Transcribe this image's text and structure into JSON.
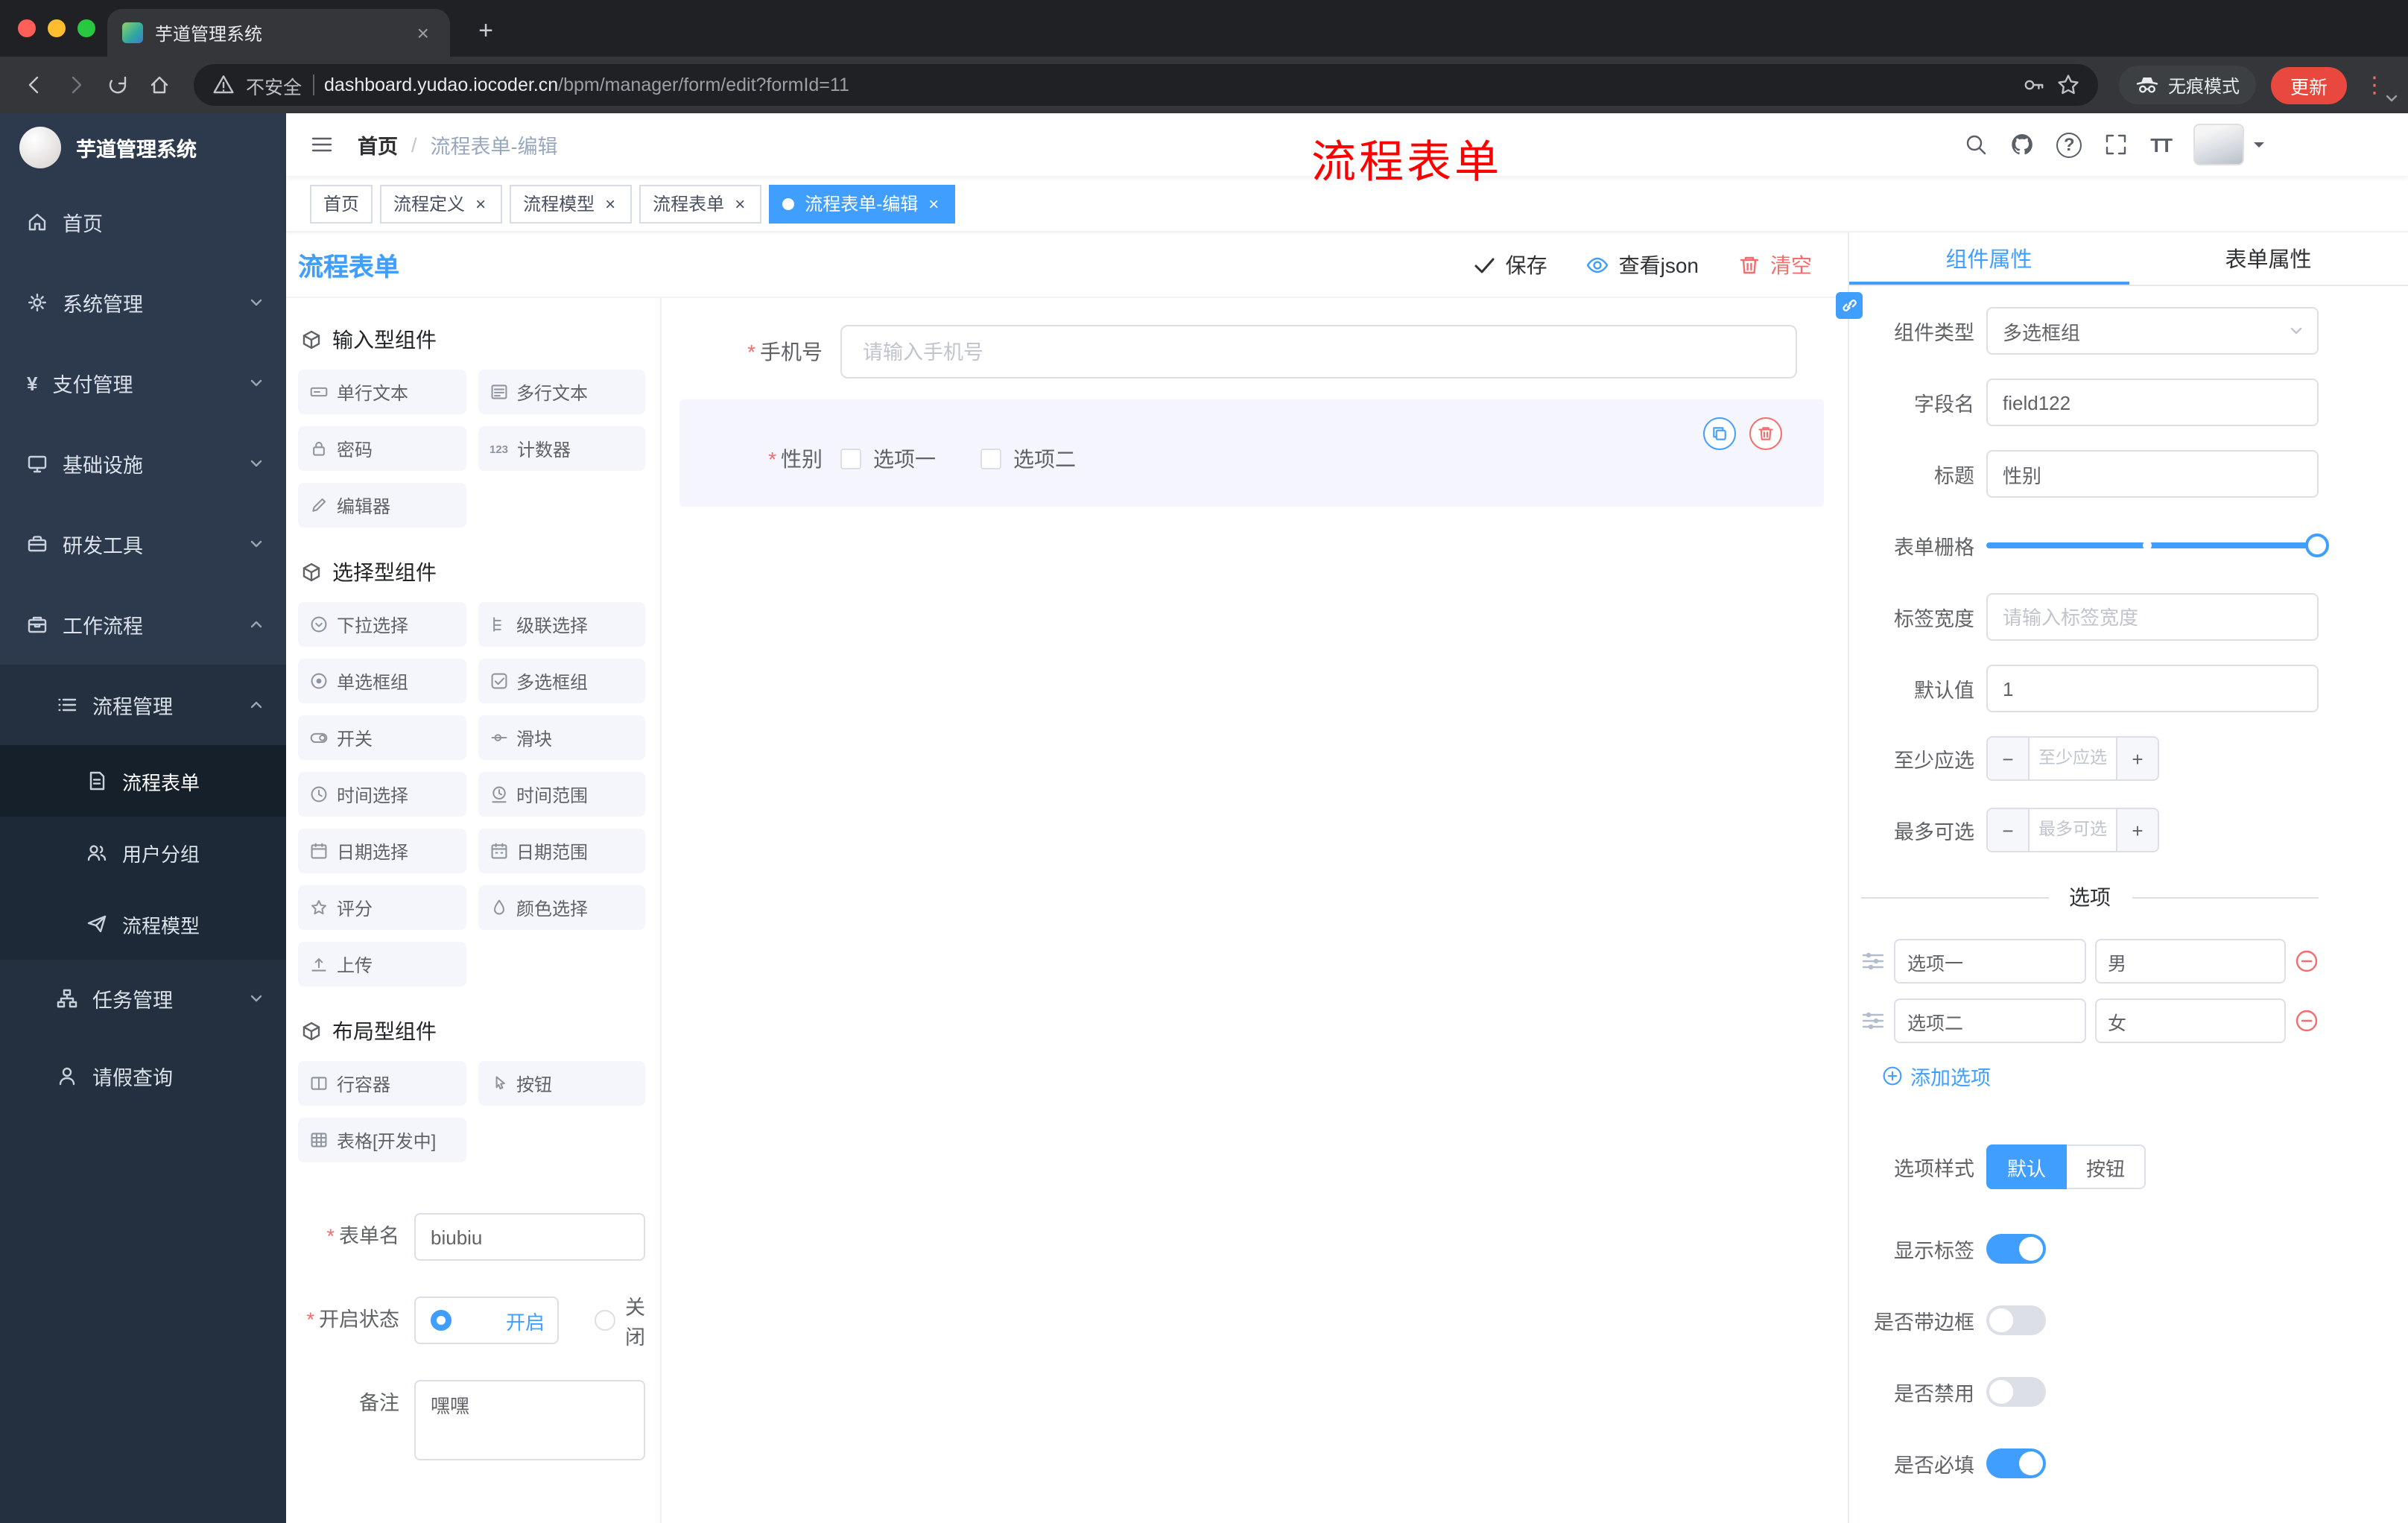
{
  "icons": {
    "close": "×",
    "plus": "+",
    "minus": "−",
    "plus_sign": "+",
    "kebab": "⋮",
    "yen": "¥",
    "counter_badge": "123",
    "font_size": "TT",
    "question_mark": "?",
    "required": "*",
    "breadcrumb_separator": "/"
  },
  "browser": {
    "tab_title": "芋道管理系统",
    "security_label": "不安全",
    "url_domain": "dashboard.yudao.iocoder.cn",
    "url_path": "/bpm/manager/form/edit?formId=11",
    "incognito_label": "无痕模式",
    "update_label": "更新"
  },
  "sidebar": {
    "logo_title": "芋道管理系统",
    "items": [
      {
        "label": "首页"
      },
      {
        "label": "系统管理"
      },
      {
        "label": "支付管理"
      },
      {
        "label": "基础设施"
      },
      {
        "label": "研发工具"
      },
      {
        "label": "工作流程"
      },
      {
        "label": "流程管理"
      },
      {
        "label": "流程表单"
      },
      {
        "label": "用户分组"
      },
      {
        "label": "流程模型"
      },
      {
        "label": "任务管理"
      },
      {
        "label": "请假查询"
      }
    ]
  },
  "navbar": {
    "breadcrumb": [
      "首页",
      "流程表单-编辑"
    ],
    "annotation": "流程表单"
  },
  "tags": [
    {
      "label": "首页",
      "closable": false,
      "active": false
    },
    {
      "label": "流程定义",
      "closable": true,
      "active": false
    },
    {
      "label": "流程模型",
      "closable": true,
      "active": false
    },
    {
      "label": "流程表单",
      "closable": true,
      "active": false
    },
    {
      "label": "流程表单-编辑",
      "closable": true,
      "active": true
    }
  ],
  "designer": {
    "title": "流程表单",
    "save_label": "保存",
    "view_json_label": "查看json",
    "clear_label": "清空"
  },
  "palette": {
    "sections": [
      {
        "title": "输入型组件",
        "items": [
          "单行文本",
          "多行文本",
          "密码",
          "计数器",
          "编辑器"
        ]
      },
      {
        "title": "选择型组件",
        "items": [
          "下拉选择",
          "级联选择",
          "单选框组",
          "多选框组",
          "开关",
          "滑块",
          "时间选择",
          "时间范围",
          "日期选择",
          "日期范围",
          "评分",
          "颜色选择",
          "上传"
        ]
      },
      {
        "title": "布局型组件",
        "items": [
          "行容器",
          "按钮",
          "表格[开发中]"
        ]
      }
    ]
  },
  "form_meta": {
    "name_label": "表单名",
    "name_value": "biubiu",
    "status_label": "开启状态",
    "status_on": "开启",
    "status_off": "关闭",
    "status_selected": "开启",
    "remark_label": "备注",
    "remark_value": "嘿嘿"
  },
  "canvas": {
    "phone_label": "手机号",
    "phone_placeholder": "请输入手机号",
    "gender_label": "性别",
    "gender_option1": "选项一",
    "gender_option2": "选项二"
  },
  "props": {
    "tab_component": "组件属性",
    "tab_form": "表单属性",
    "active_tab": "组件属性",
    "component_type_label": "组件类型",
    "component_type_value": "多选框组",
    "field_name_label": "字段名",
    "field_name_value": "field122",
    "title_label": "标题",
    "title_value": "性别",
    "grid_label": "表单栅格",
    "label_width_label": "标签宽度",
    "label_width_placeholder": "请输入标签宽度",
    "default_label": "默认值",
    "default_value": "1",
    "min_label": "至少应选",
    "min_placeholder": "至少应选",
    "max_label": "最多可选",
    "max_placeholder": "最多可选",
    "options_title": "选项",
    "options": [
      {
        "label": "选项一",
        "value": "男"
      },
      {
        "label": "选项二",
        "value": "女"
      }
    ],
    "add_option_label": "添加选项",
    "style_label": "选项样式",
    "style_default": "默认",
    "style_button": "按钮",
    "style_selected": "默认",
    "show_label": "显示标签",
    "show_label_on": true,
    "border_label": "是否带边框",
    "border_on": false,
    "disabled_label": "是否禁用",
    "disabled_on": false,
    "required_label": "是否必填",
    "required_on": true
  }
}
